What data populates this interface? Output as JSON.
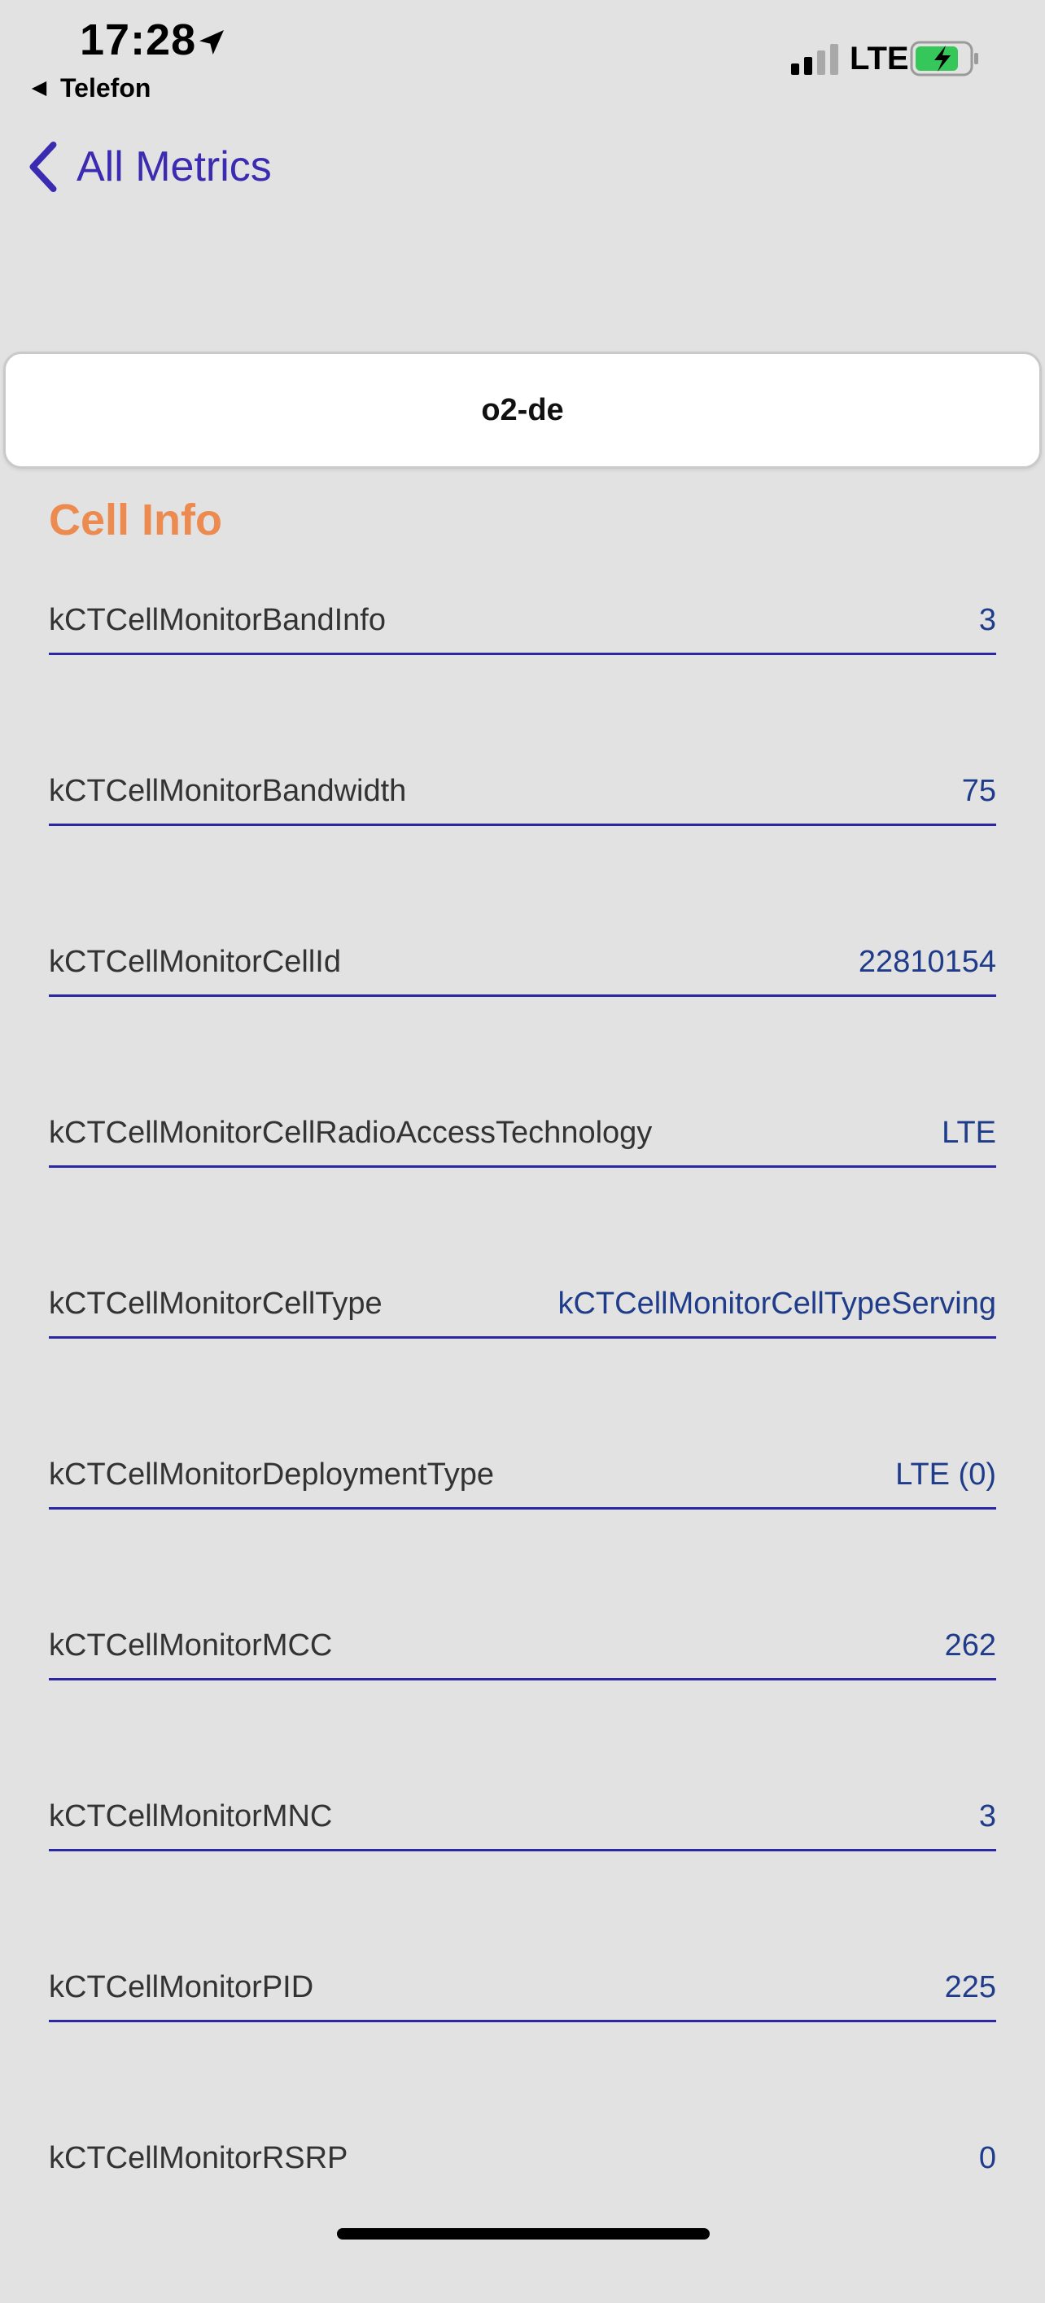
{
  "status_bar": {
    "time": "17:28",
    "back_app": "Telefon",
    "network": "LTE"
  },
  "nav": {
    "back_label": "All Metrics"
  },
  "carrier": {
    "name": "o2-de"
  },
  "section": {
    "title": "Cell Info",
    "title_color": "#ec8a4f"
  },
  "rows": [
    {
      "label": "kCTCellMonitorBandInfo",
      "value": "3"
    },
    {
      "label": "kCTCellMonitorBandwidth",
      "value": "75"
    },
    {
      "label": "kCTCellMonitorCellId",
      "value": "22810154"
    },
    {
      "label": "kCTCellMonitorCellRadioAccessTechnology",
      "value": "LTE"
    },
    {
      "label": "kCTCellMonitorCellType",
      "value": "kCTCellMonitorCellTypeServing"
    },
    {
      "label": "kCTCellMonitorDeploymentType",
      "value": "LTE (0)"
    },
    {
      "label": "kCTCellMonitorMCC",
      "value": "262"
    },
    {
      "label": "kCTCellMonitorMNC",
      "value": "3"
    },
    {
      "label": "kCTCellMonitorPID",
      "value": "225"
    },
    {
      "label": "kCTCellMonitorRSRP",
      "value": "0"
    }
  ],
  "icons": {
    "location": "location-arrow-icon",
    "signal": "signal-bars-icon",
    "battery": "battery-charging-icon",
    "back": "chevron-left-icon"
  },
  "colors": {
    "accent": "#3b2bb0",
    "value_text": "#1f3c8a",
    "battery_fill": "#35c759",
    "background": "#e2e2e3"
  }
}
